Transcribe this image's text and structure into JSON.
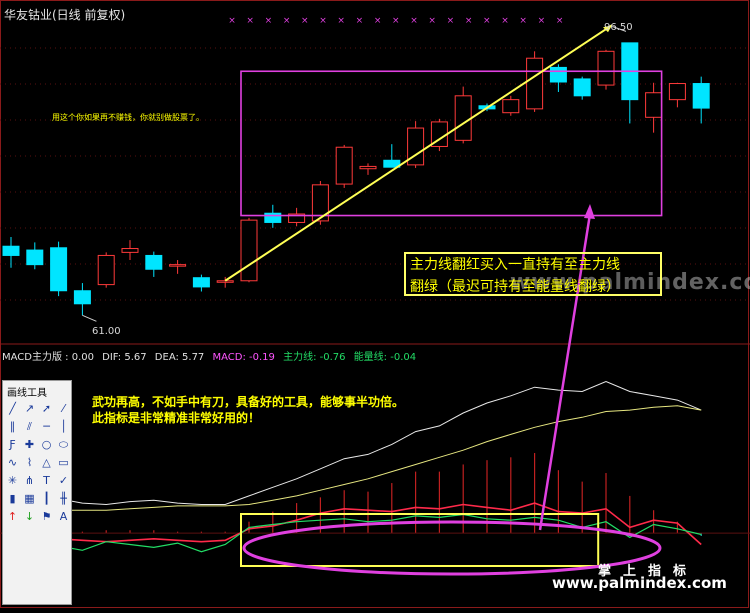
{
  "stock": {
    "title": "华友钴业(日线 前复权)"
  },
  "annotations": {
    "price_high": "96.50",
    "price_low": "61.00",
    "note_top": "用这个你如果再不赚钱，你就别做股票了。",
    "note_mid_1": "武功再高，不如手中有刀，具备好的工具，能够事半功倍。",
    "note_mid_2": "此指标是非常精准非常好用的！",
    "callout_1": "主力线翻红买入一直持有至主力线",
    "callout_2": "翻绿（最迟可持有至能量线翻绿）",
    "watermark": "www.palmindex.com"
  },
  "macd": {
    "name": "MACD主力版 : 0.00",
    "dif": "DIF: 5.67",
    "dea": "DEA: 5.77",
    "macd": "MACD: -0.19",
    "main": "主力线: -0.76",
    "energy": "能量线: -0.04"
  },
  "colors": {
    "up": "#ff3a3a",
    "down": "#00e5ff",
    "dif": "#e8e8e8",
    "dea": "#e6e680",
    "main_line": "#ff2a4a",
    "energy_line": "#22dd66",
    "macd_label": "#ff55ff",
    "magenta": "#e040e0",
    "yellow": "#ffff55"
  },
  "toolbox": {
    "title": "画线工具",
    "tools": [
      "line-icon",
      "ray-icon",
      "arrow-line-icon",
      "segment-icon",
      "parallel-icon",
      "channel-icon",
      "horizontal-icon",
      "vertical-icon",
      "fib-icon",
      "cross-icon",
      "circle-icon",
      "ellipse-icon",
      "wave-icon",
      "zigzag-icon",
      "triangle-icon",
      "rect-icon",
      "gann-icon",
      "pitchfork-icon",
      "text-icon",
      "mark-icon",
      "bars-icon",
      "grid-icon",
      "ruler-icon",
      "period-icon",
      "up-arrow-icon",
      "down-arrow-icon",
      "flag-icon",
      "letter-a-icon"
    ]
  },
  "brand": {
    "cn": "掌上指标",
    "url": "www.palmindex.com"
  },
  "chart_data": [
    {
      "type": "candlestick",
      "title": "华友钴业(日线 前复权)",
      "ylim": [
        57,
        100
      ],
      "candles": [
        {
          "o": 70.0,
          "h": 71.2,
          "l": 67.2,
          "c": 68.8
        },
        {
          "o": 69.5,
          "h": 70.5,
          "l": 67.0,
          "c": 67.6
        },
        {
          "o": 69.8,
          "h": 70.6,
          "l": 63.5,
          "c": 64.2
        },
        {
          "o": 64.2,
          "h": 65.2,
          "l": 61.0,
          "c": 62.5
        },
        {
          "o": 65.0,
          "h": 69.2,
          "l": 64.6,
          "c": 68.8
        },
        {
          "o": 69.2,
          "h": 70.8,
          "l": 68.2,
          "c": 69.7
        },
        {
          "o": 68.8,
          "h": 69.3,
          "l": 66.0,
          "c": 67.0
        },
        {
          "o": 67.6,
          "h": 68.2,
          "l": 66.4,
          "c": 67.6
        },
        {
          "o": 65.9,
          "h": 66.3,
          "l": 64.1,
          "c": 64.7
        },
        {
          "o": 65.5,
          "h": 66.0,
          "l": 64.6,
          "c": 65.5
        },
        {
          "o": 65.5,
          "h": 73.7,
          "l": 65.3,
          "c": 73.4
        },
        {
          "o": 74.3,
          "h": 75.4,
          "l": 72.4,
          "c": 73.1
        },
        {
          "o": 73.1,
          "h": 75.0,
          "l": 72.6,
          "c": 74.2
        },
        {
          "o": 73.3,
          "h": 78.5,
          "l": 72.8,
          "c": 78.0
        },
        {
          "o": 78.1,
          "h": 83.2,
          "l": 77.6,
          "c": 82.9
        },
        {
          "o": 80.1,
          "h": 80.8,
          "l": 79.3,
          "c": 80.4
        },
        {
          "o": 81.2,
          "h": 83.3,
          "l": 80.3,
          "c": 80.3
        },
        {
          "o": 80.6,
          "h": 86.3,
          "l": 80.2,
          "c": 85.4
        },
        {
          "o": 83.0,
          "h": 86.6,
          "l": 82.4,
          "c": 86.2
        },
        {
          "o": 83.8,
          "h": 90.8,
          "l": 83.4,
          "c": 89.6
        },
        {
          "o": 88.3,
          "h": 88.6,
          "l": 87.6,
          "c": 87.9
        },
        {
          "o": 87.4,
          "h": 89.6,
          "l": 87.0,
          "c": 89.1
        },
        {
          "o": 87.9,
          "h": 95.4,
          "l": 87.5,
          "c": 94.5
        },
        {
          "o": 93.3,
          "h": 93.7,
          "l": 90.1,
          "c": 91.4
        },
        {
          "o": 91.8,
          "h": 92.1,
          "l": 89.1,
          "c": 89.6
        },
        {
          "o": 91.0,
          "h": 95.6,
          "l": 90.4,
          "c": 95.4
        },
        {
          "o": 96.5,
          "h": 96.5,
          "l": 86.0,
          "c": 89.1
        },
        {
          "o": 86.8,
          "h": 91.3,
          "l": 84.8,
          "c": 90.0
        },
        {
          "o": 89.1,
          "h": 91.3,
          "l": 88.1,
          "c": 91.2
        },
        {
          "o": 91.2,
          "h": 92.1,
          "l": 86.0,
          "c": 88.0
        }
      ],
      "annotations": [
        "96.50",
        "61.00"
      ]
    },
    {
      "type": "line",
      "title": "MACD主力版 : 0.00",
      "ylim": [
        -3,
        14
      ],
      "series": [
        {
          "name": "DIF",
          "values": [
            2.6,
            2.6,
            2.4,
            2.1,
            2.0,
            2.2,
            2.3,
            2.1,
            2.0,
            2.0,
            2.6,
            3.2,
            3.8,
            4.5,
            5.2,
            5.5,
            6.2,
            7.1,
            7.5,
            8.4,
            9.1,
            9.6,
            10.2,
            10.0,
            9.9,
            10.6,
            9.9,
            9.6,
            9.3,
            8.6
          ]
        },
        {
          "name": "DEA",
          "values": [
            1.4,
            1.5,
            1.6,
            1.6,
            1.6,
            1.7,
            1.8,
            1.9,
            1.9,
            1.9,
            2.0,
            2.3,
            2.6,
            3.0,
            3.4,
            3.8,
            4.3,
            4.8,
            5.3,
            5.8,
            6.4,
            6.9,
            7.4,
            7.8,
            8.1,
            8.5,
            8.6,
            8.8,
            8.9,
            8.6
          ]
        },
        {
          "name": "主力线",
          "values": [
            -0.3,
            -0.3,
            -0.4,
            -0.5,
            -0.6,
            -0.5,
            -0.4,
            -0.5,
            -0.6,
            -0.5,
            0.3,
            0.5,
            0.9,
            1.4,
            1.7,
            1.6,
            1.5,
            1.8,
            1.7,
            2.0,
            1.8,
            1.6,
            2.1,
            1.5,
            1.4,
            1.7,
            0.4,
            0.9,
            0.7,
            -0.8
          ]
        },
        {
          "name": "能量线",
          "values": [
            -0.5,
            -0.4,
            -0.9,
            -1.2,
            -0.6,
            -0.8,
            -1.0,
            -0.7,
            -1.3,
            -0.8,
            0.4,
            0.6,
            0.8,
            0.9,
            1.0,
            0.8,
            0.9,
            1.2,
            1.1,
            1.3,
            1.0,
            0.9,
            1.1,
            0.9,
            0.4,
            0.8,
            -0.3,
            0.6,
            0.3,
            -0.1
          ]
        },
        {
          "name": "MACD",
          "values": [
            0.2,
            0.3,
            0.2,
            0.1,
            0.2,
            0.2,
            0.2,
            0.1,
            0.1,
            0.1,
            0.8,
            1.5,
            2.1,
            2.5,
            3.0,
            2.9,
            3.5,
            4.3,
            4.3,
            4.8,
            5.1,
            5.3,
            5.6,
            4.4,
            3.6,
            4.2,
            2.6,
            1.6,
            0.8,
            -0.2
          ]
        }
      ]
    }
  ]
}
